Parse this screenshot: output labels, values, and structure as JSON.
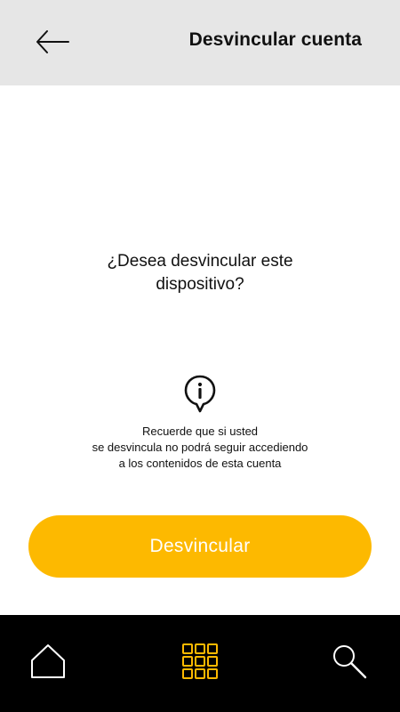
{
  "header": {
    "back_icon": "arrow-left-icon",
    "title": "Desvincular cuenta"
  },
  "main": {
    "question_line1": "¿Desea desvincular este",
    "question_line2": "dispositivo?",
    "info_icon": "info-pin-icon",
    "note_line1": "Recuerde que si usted",
    "note_line2": "se desvincula no podrá seguir accediendo",
    "note_line3": "a los contenidos de esta cuenta",
    "button_label": "Desvincular"
  },
  "bottom_nav": {
    "items": [
      {
        "icon": "home-icon",
        "active": false
      },
      {
        "icon": "grid-icon",
        "active": true
      },
      {
        "icon": "search-icon",
        "active": false
      }
    ]
  },
  "colors": {
    "accent": "#fdb900",
    "header_bg": "#e6e6e6",
    "nav_bg": "#000000",
    "nav_inactive": "#ffffff"
  }
}
